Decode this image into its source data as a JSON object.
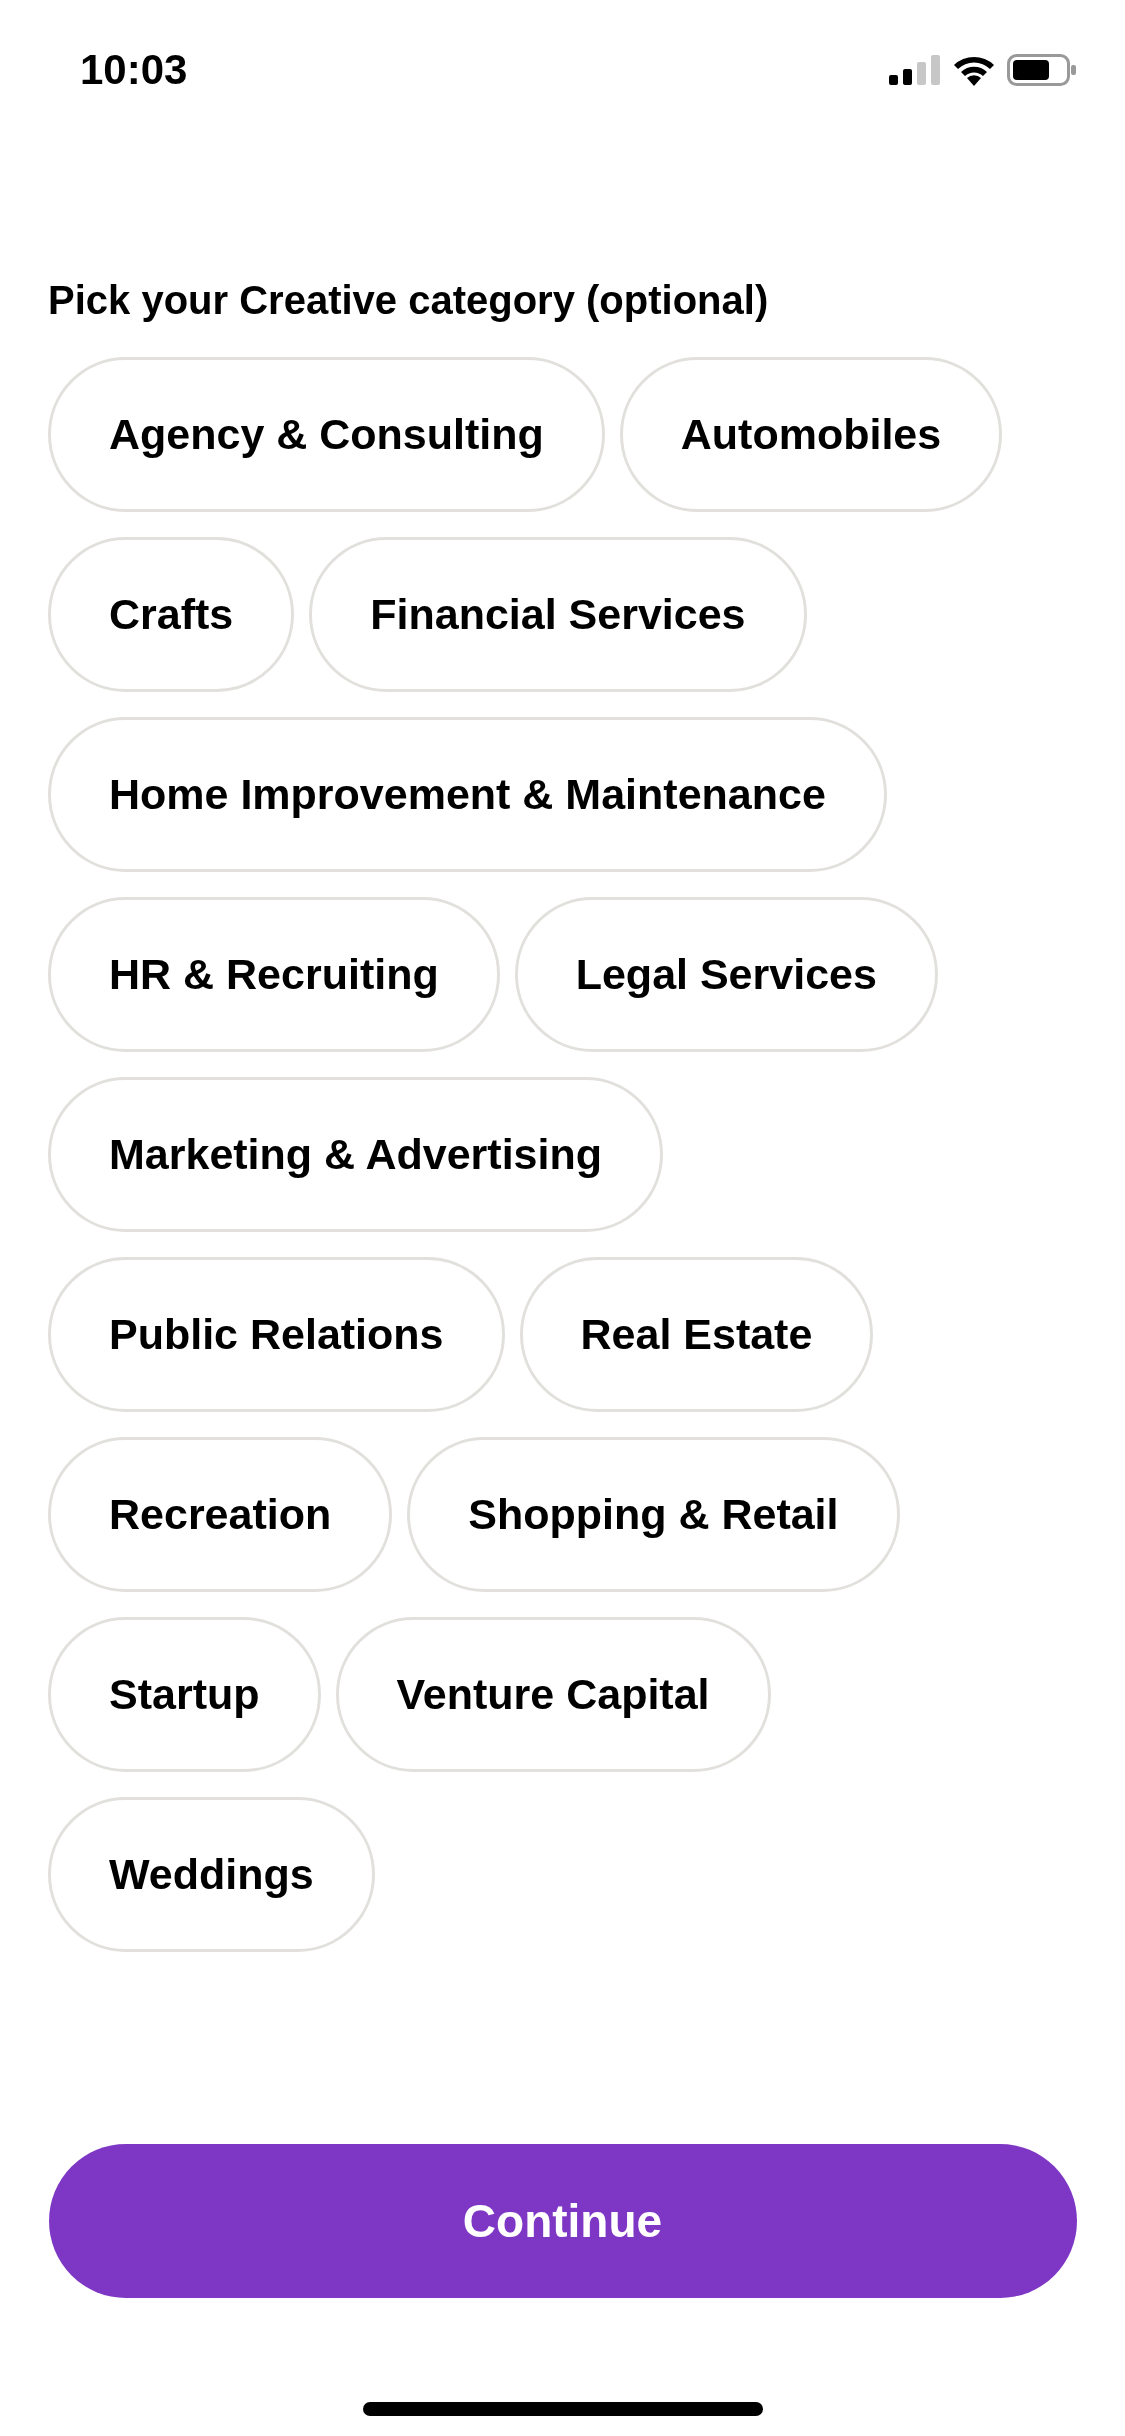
{
  "status_bar": {
    "time": "10:03"
  },
  "title": "Pick your Creative category (optional)",
  "categories": [
    {
      "label": "Agency & Consulting",
      "selected": false
    },
    {
      "label": "Automobiles",
      "selected": false
    },
    {
      "label": "Crafts",
      "selected": false
    },
    {
      "label": "Financial Services",
      "selected": false
    },
    {
      "label": "Home Improvement & Maintenance",
      "selected": false
    },
    {
      "label": "HR & Recruiting",
      "selected": false
    },
    {
      "label": "Legal Services",
      "selected": false
    },
    {
      "label": "Marketing & Advertising",
      "selected": false
    },
    {
      "label": "Public Relations",
      "selected": false
    },
    {
      "label": "Real Estate",
      "selected": false
    },
    {
      "label": "Recreation",
      "selected": false
    },
    {
      "label": "Shopping & Retail",
      "selected": false
    },
    {
      "label": "Startup",
      "selected": false
    },
    {
      "label": "Venture Capital",
      "selected": false
    },
    {
      "label": "Weddings",
      "selected": false
    }
  ],
  "continue_button": {
    "label": "Continue"
  }
}
